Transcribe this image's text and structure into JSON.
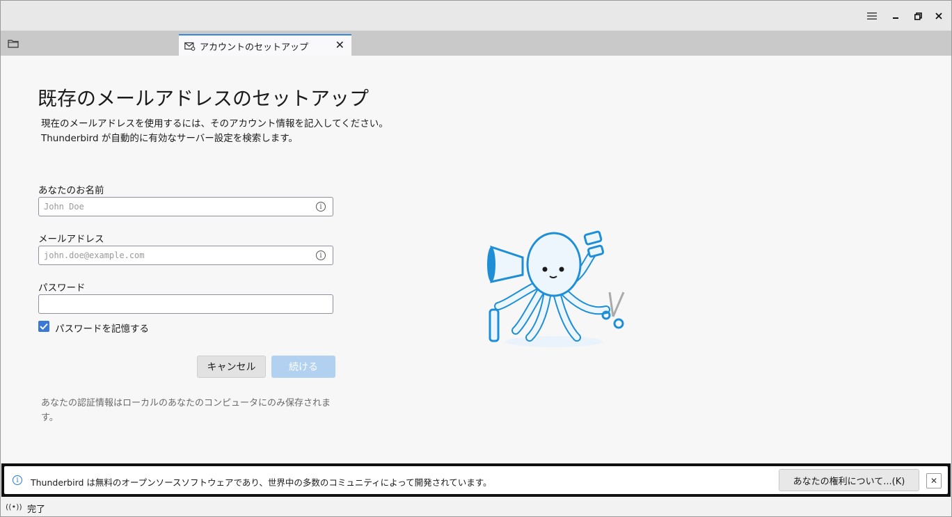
{
  "window": {
    "controls": [
      "menu-icon",
      "minimize-icon",
      "maximize-icon",
      "close-icon"
    ]
  },
  "tabs": [
    {
      "label": "アカウントのセットアップ",
      "icon": "mail-setup-icon",
      "active": true
    }
  ],
  "setup": {
    "title": "既存のメールアドレスのセットアップ",
    "subtitle_line1": "現在のメールアドレスを使用するには、そのアカウント情報を記入してください。",
    "subtitle_line2": "Thunderbird が自動的に有効なサーバー設定を検索します。",
    "name_label": "あなたのお名前",
    "name_placeholder": "John Doe",
    "email_label": "メールアドレス",
    "email_placeholder": "john.doe@example.com",
    "password_label": "パスワード",
    "password_value": "",
    "remember_label": "パスワードを記憶する",
    "remember_checked": true,
    "cancel_label": "キャンセル",
    "continue_label": "続ける",
    "note": "あなたの認証情報はローカルのあなたのコンピュータにのみ保存されます。"
  },
  "notification": {
    "text": "Thunderbird は無料のオープンソースソフトウェアであり、世界中の多数のコミュニティによって開発されています。",
    "button_label": "あなたの権利について...(K)",
    "close_label": "✕"
  },
  "status": {
    "text": "完了"
  },
  "colors": {
    "accent": "#3a79d6",
    "continue_disabled": "#b2d1f0",
    "octopus_blue": "#1e8fd6"
  }
}
